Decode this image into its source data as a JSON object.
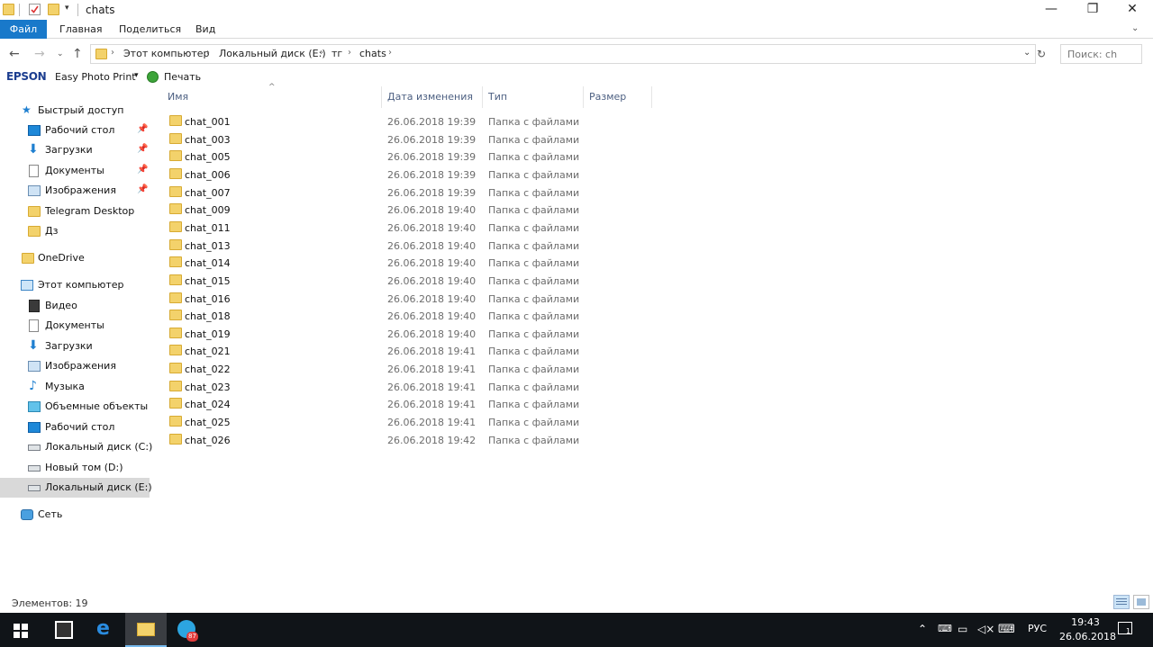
{
  "window": {
    "title": "chats",
    "controls": {
      "minimize": "—",
      "maximize": "❐",
      "close": "✕"
    }
  },
  "ribbon": {
    "tabs": [
      "Файл",
      "Главная",
      "Поделиться",
      "Вид"
    ]
  },
  "address": {
    "breadcrumbs": [
      "Этот компьютер",
      "Локальный диск (E:)",
      "тг",
      "chats"
    ],
    "search_placeholder": "Поиск: ch"
  },
  "epson_toolbar": {
    "brand": "EPSON",
    "app_label": "Easy Photo Print",
    "print_label": "Печать"
  },
  "columns": {
    "name": "Имя",
    "date": "Дата изменения",
    "type": "Тип",
    "size": "Размер"
  },
  "navigation": {
    "quick_access": "Быстрый доступ",
    "quick_items": [
      {
        "label": "Рабочий стол",
        "icon": "desktop-icon",
        "pinned": true
      },
      {
        "label": "Загрузки",
        "icon": "download-icon",
        "pinned": true
      },
      {
        "label": "Документы",
        "icon": "documents-icon",
        "pinned": true
      },
      {
        "label": "Изображения",
        "icon": "pictures-icon",
        "pinned": true
      },
      {
        "label": "Telegram Desktop",
        "icon": "folder-icon",
        "pinned": false
      },
      {
        "label": "Дз",
        "icon": "folder-icon",
        "pinned": false
      }
    ],
    "onedrive": "OneDrive",
    "this_pc": "Этот компьютер",
    "pc_items": [
      {
        "label": "Видео",
        "icon": "video-icon"
      },
      {
        "label": "Документы",
        "icon": "documents-icon"
      },
      {
        "label": "Загрузки",
        "icon": "download-icon"
      },
      {
        "label": "Изображения",
        "icon": "pictures-icon"
      },
      {
        "label": "Музыка",
        "icon": "music-icon"
      },
      {
        "label": "Объемные объекты",
        "icon": "3d-objects-icon"
      },
      {
        "label": "Рабочий стол",
        "icon": "desktop-icon"
      },
      {
        "label": "Локальный диск (C:)",
        "icon": "drive-icon"
      },
      {
        "label": "Новый том (D:)",
        "icon": "drive-icon"
      },
      {
        "label": "Локальный диск (E:)",
        "icon": "drive-icon",
        "selected": true
      }
    ],
    "network": "Сеть"
  },
  "files": [
    {
      "name": "chat_001",
      "date": "26.06.2018 19:39",
      "type": "Папка с файлами"
    },
    {
      "name": "chat_003",
      "date": "26.06.2018 19:39",
      "type": "Папка с файлами"
    },
    {
      "name": "chat_005",
      "date": "26.06.2018 19:39",
      "type": "Папка с файлами"
    },
    {
      "name": "chat_006",
      "date": "26.06.2018 19:39",
      "type": "Папка с файлами"
    },
    {
      "name": "chat_007",
      "date": "26.06.2018 19:39",
      "type": "Папка с файлами"
    },
    {
      "name": "chat_009",
      "date": "26.06.2018 19:40",
      "type": "Папка с файлами"
    },
    {
      "name": "chat_011",
      "date": "26.06.2018 19:40",
      "type": "Папка с файлами"
    },
    {
      "name": "chat_013",
      "date": "26.06.2018 19:40",
      "type": "Папка с файлами"
    },
    {
      "name": "chat_014",
      "date": "26.06.2018 19:40",
      "type": "Папка с файлами"
    },
    {
      "name": "chat_015",
      "date": "26.06.2018 19:40",
      "type": "Папка с файлами"
    },
    {
      "name": "chat_016",
      "date": "26.06.2018 19:40",
      "type": "Папка с файлами"
    },
    {
      "name": "chat_018",
      "date": "26.06.2018 19:40",
      "type": "Папка с файлами"
    },
    {
      "name": "chat_019",
      "date": "26.06.2018 19:40",
      "type": "Папка с файлами"
    },
    {
      "name": "chat_021",
      "date": "26.06.2018 19:41",
      "type": "Папка с файлами"
    },
    {
      "name": "chat_022",
      "date": "26.06.2018 19:41",
      "type": "Папка с файлами"
    },
    {
      "name": "chat_023",
      "date": "26.06.2018 19:41",
      "type": "Папка с файлами"
    },
    {
      "name": "chat_024",
      "date": "26.06.2018 19:41",
      "type": "Папка с файлами"
    },
    {
      "name": "chat_025",
      "date": "26.06.2018 19:41",
      "type": "Папка с файлами"
    },
    {
      "name": "chat_026",
      "date": "26.06.2018 19:42",
      "type": "Папка с файлами"
    }
  ],
  "status": {
    "items_count": "Элементов: 19"
  },
  "taskbar": {
    "language": "РУС",
    "time": "19:43",
    "date": "26.06.2018",
    "telegram_badge": "87",
    "notification_count": "1"
  },
  "colors": {
    "accent": "#1979ca",
    "folder": "#f3d26b",
    "column_header_text": "#4d6082",
    "taskbar": "#101418"
  }
}
